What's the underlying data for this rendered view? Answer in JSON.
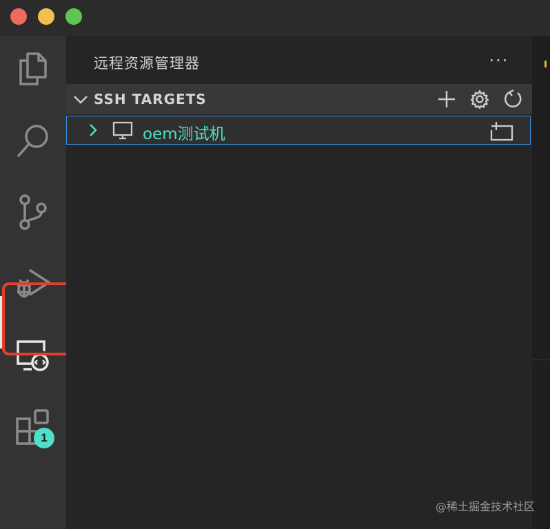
{
  "window": {
    "controls": [
      "close",
      "minimize",
      "maximize"
    ],
    "colors": {
      "close": "#ed6a5e",
      "minimize": "#f5bf4f",
      "maximize": "#61c554"
    }
  },
  "activity_bar": {
    "items": [
      {
        "icon": "files-icon"
      },
      {
        "icon": "search-icon"
      },
      {
        "icon": "source-control-icon"
      },
      {
        "icon": "run-debug-icon"
      },
      {
        "icon": "remote-explorer-icon",
        "active": true,
        "highlighted": true
      },
      {
        "icon": "extensions-icon",
        "badge": "1"
      }
    ],
    "highlight_color": "#e0412f",
    "badge_color": "#4fe0c8"
  },
  "sidebar": {
    "title": "远程资源管理器",
    "more_label": "···",
    "section": {
      "title": "SSH TARGETS",
      "actions": [
        "add-icon",
        "gear-icon",
        "refresh-icon"
      ],
      "items": [
        {
          "label": "oem测试机",
          "icon": "monitor-icon",
          "action": "open-in-new-window-icon"
        }
      ]
    }
  },
  "watermark": "@稀土掘金技术社区",
  "colors": {
    "accent": "#4fe0c8",
    "focus_border": "#3b8ee5",
    "sidebar_bg": "#252526",
    "activity_bg": "#333334"
  }
}
